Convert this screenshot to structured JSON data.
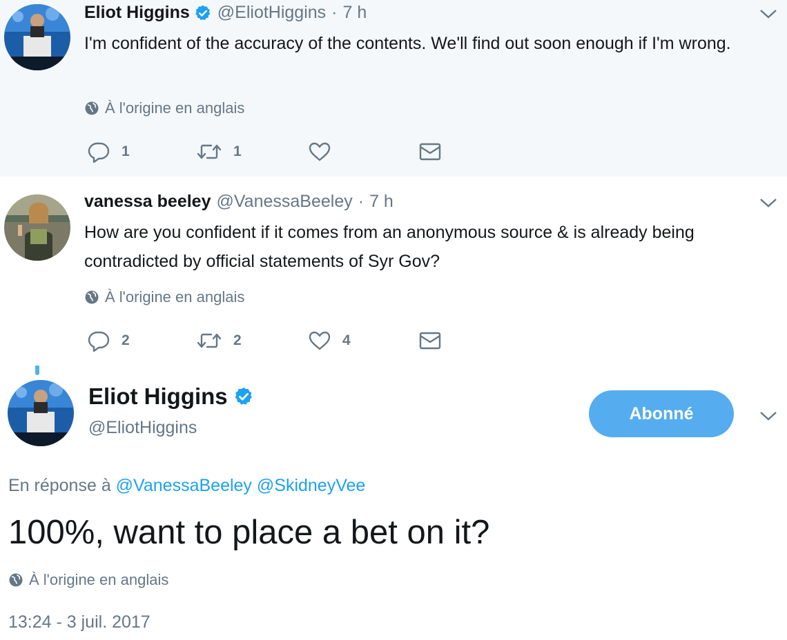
{
  "tweets": [
    {
      "name": "Eliot Higgins",
      "handle": "@EliotHiggins",
      "separator": "·",
      "time": "7 h",
      "text": "I'm confident of the accuracy of the contents. We'll find out soon enough if I'm wrong.",
      "translate": "À l'origine en anglais",
      "replies": "1",
      "retweets": "1",
      "likes": ""
    },
    {
      "name": "vanessa beeley",
      "handle": "@VanessaBeeley",
      "separator": "·",
      "time": "7 h",
      "text": "How are you confident if it comes from an anonymous source & is already being contradicted by official statements of Syr Gov?",
      "translate": "À l'origine en anglais",
      "replies": "2",
      "retweets": "2",
      "likes": "4"
    }
  ],
  "main": {
    "name": "Eliot Higgins",
    "handle": "@EliotHiggins",
    "follow_label": "Abonné",
    "reply_prefix": "En réponse à",
    "reply_to_1": "@VanessaBeeley",
    "reply_to_2": "@SkidneyVee",
    "text": "100%, want to place a bet on it?",
    "translate": "À l'origine en anglais",
    "timestamp": "13:24 - 3 juil. 2017"
  },
  "colors": {
    "accent": "#1da1f2",
    "button": "#55acee",
    "thread_line": "#4fb3e8",
    "muted": "#657786",
    "highlight_bg": "#f5f8fa"
  },
  "icons": [
    "verified-badge-icon",
    "globe-icon",
    "reply-icon",
    "retweet-icon",
    "heart-icon",
    "dm-envelope-icon",
    "chevron-down-icon"
  ]
}
